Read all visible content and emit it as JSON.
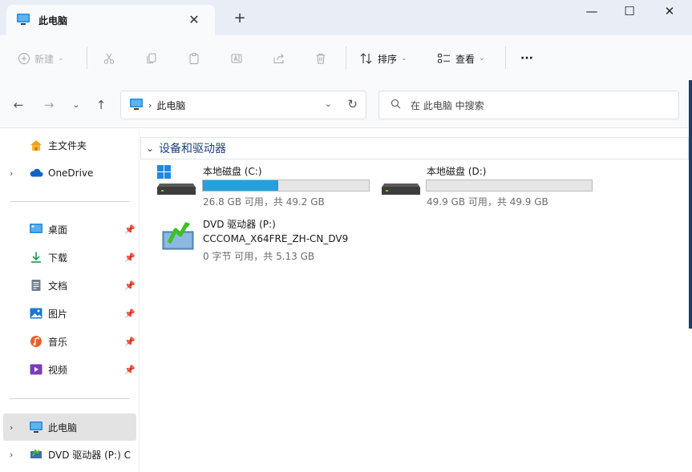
{
  "window": {
    "tab_title": "此电脑",
    "tab_close": "✕",
    "new_tab": "+",
    "minimize": "—",
    "maximize": "☐",
    "close": "✕"
  },
  "toolbar": {
    "new_label": "新建",
    "sort_label": "排序",
    "view_label": "查看",
    "more_label": "···"
  },
  "address": {
    "path": "此电脑",
    "search_placeholder": "在 此电脑 中搜索"
  },
  "sidebar": {
    "home": "主文件夹",
    "onedrive": "OneDrive",
    "quick": [
      {
        "label": "桌面"
      },
      {
        "label": "下载"
      },
      {
        "label": "文档"
      },
      {
        "label": "图片"
      },
      {
        "label": "音乐"
      },
      {
        "label": "视频"
      }
    ],
    "this_pc": "此电脑",
    "dvd": "DVD 驱动器 (P:) C"
  },
  "content": {
    "group_title": "设备和驱动器",
    "drives": [
      {
        "name": "本地磁盘 (C:)",
        "info": "26.8 GB 可用，共 49.2 GB",
        "used_fraction": 0.455
      },
      {
        "name": "本地磁盘 (D:)",
        "info": "49.9 GB 可用，共 49.9 GB",
        "used_fraction": 0.0
      },
      {
        "name": "DVD 驱动器 (P:)",
        "volume": "CCCOMA_X64FRE_ZH-CN_DV9",
        "info": "0 字节 可用，共 5.13 GB"
      }
    ]
  },
  "colors": {
    "accent": "#26a0da",
    "titlebar_bg": "#e9eef6",
    "selected_bg": "#e3e3e3",
    "group_text": "#1f3f7a"
  }
}
